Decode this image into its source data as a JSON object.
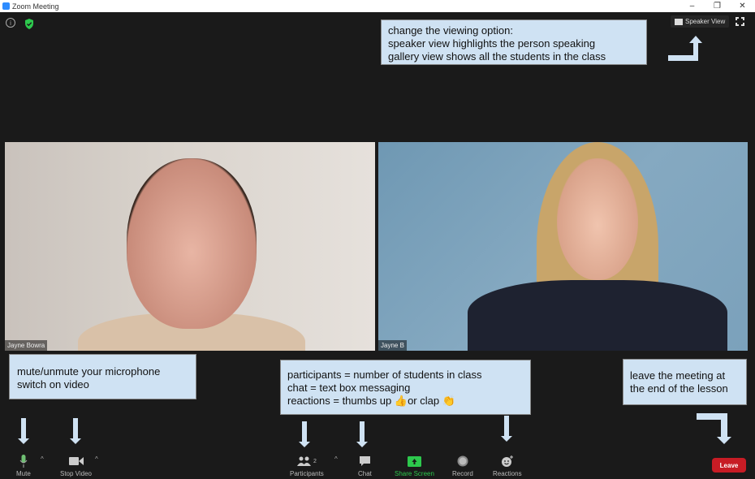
{
  "window": {
    "title": "Zoom Meeting",
    "minimize": "–",
    "restore": "❐",
    "close": "✕"
  },
  "top": {
    "info_icon": "i",
    "speaker_view_label": "Speaker View"
  },
  "notes": {
    "view": [
      "change the viewing option:",
      "speaker view highlights the person speaking",
      "gallery view shows all the students in the class"
    ],
    "mic": [
      "mute/unmute your microphone",
      "switch on video"
    ],
    "participants": [
      "participants = number of students in class",
      "chat = text box messaging",
      "reactions = thumbs up 👍or clap 👏"
    ],
    "leave": [
      "leave the meeting at",
      "the end of the lesson"
    ]
  },
  "videos": [
    {
      "name": "Jayne Bowra"
    },
    {
      "name": "Jayne B"
    }
  ],
  "toolbar": {
    "mute": "Mute",
    "stop_video": "Stop Video",
    "participants": "Participants",
    "participants_count": "2",
    "chat": "Chat",
    "share_screen": "Share Screen",
    "record": "Record",
    "reactions": "Reactions",
    "leave": "Leave"
  },
  "colors": {
    "share_green": "#2dc84d",
    "leave_red": "#c71c25",
    "note_bg": "#cfe2f3"
  }
}
